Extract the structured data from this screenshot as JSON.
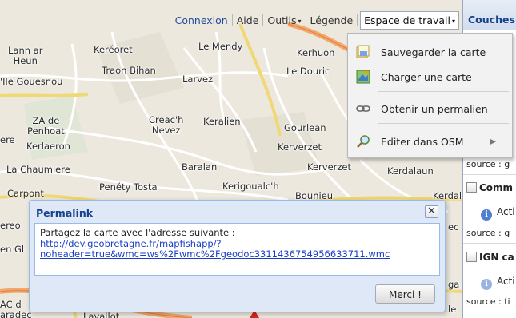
{
  "toolbar": {
    "connexion": "Connexion",
    "aide": "Aide",
    "outils": "Outils",
    "legende": "Légende",
    "espace": "Espace de travail",
    "arrow": "▾"
  },
  "menu": {
    "items": [
      {
        "label": "Sauvegarder la carte",
        "icon": "save-map-icon"
      },
      {
        "label": "Charger une carte",
        "icon": "load-map-icon"
      },
      {
        "label": "Obtenir un permalien",
        "icon": "link-icon"
      },
      {
        "label": "Editer dans OSM",
        "icon": "search-edit-icon",
        "submenu_arrow": "▶"
      }
    ]
  },
  "map": {
    "places": [
      "Lann ar\nHeun",
      "Keréoret",
      "Le Mendy",
      "Kerhuon",
      "Traon Bihan",
      "Larvez",
      "'Ile Gouesnou",
      "Le Douric",
      "ZA de\nPenhoat",
      "Creac'h\nNevez",
      "Keralien",
      "Gourlean",
      "ere",
      "Kerlaeron",
      "Kerverzet",
      "La Chaumiere",
      "Baralan",
      "Kerverzet",
      "Kerdalaun",
      "Carpont",
      "Penéty Tosta",
      "Kerigoualc'h",
      "Bounieu",
      "Kerdal",
      "ereo",
      "en Gl",
      "ec",
      "ga",
      "AC d",
      "aradec",
      "Lavallot",
      "le"
    ]
  },
  "panel": {
    "header": "Couches",
    "sources": [
      "source : g",
      "source : g",
      "source : ti"
    ],
    "layers": [
      "Comm",
      "IGN ca"
    ],
    "action": "Acti",
    "info_glyph": "i"
  },
  "permalink": {
    "title": "Permalink",
    "close_glyph": "✕",
    "message": "Partagez la carte avec l'adresse suivante :",
    "url": "http://dev.geobretagne.fr/mapfishapp/?noheader=true&wmc=ws%2Fwmc%2Fgeodoc3311436754956633711.wmc",
    "button": "Merci !"
  }
}
